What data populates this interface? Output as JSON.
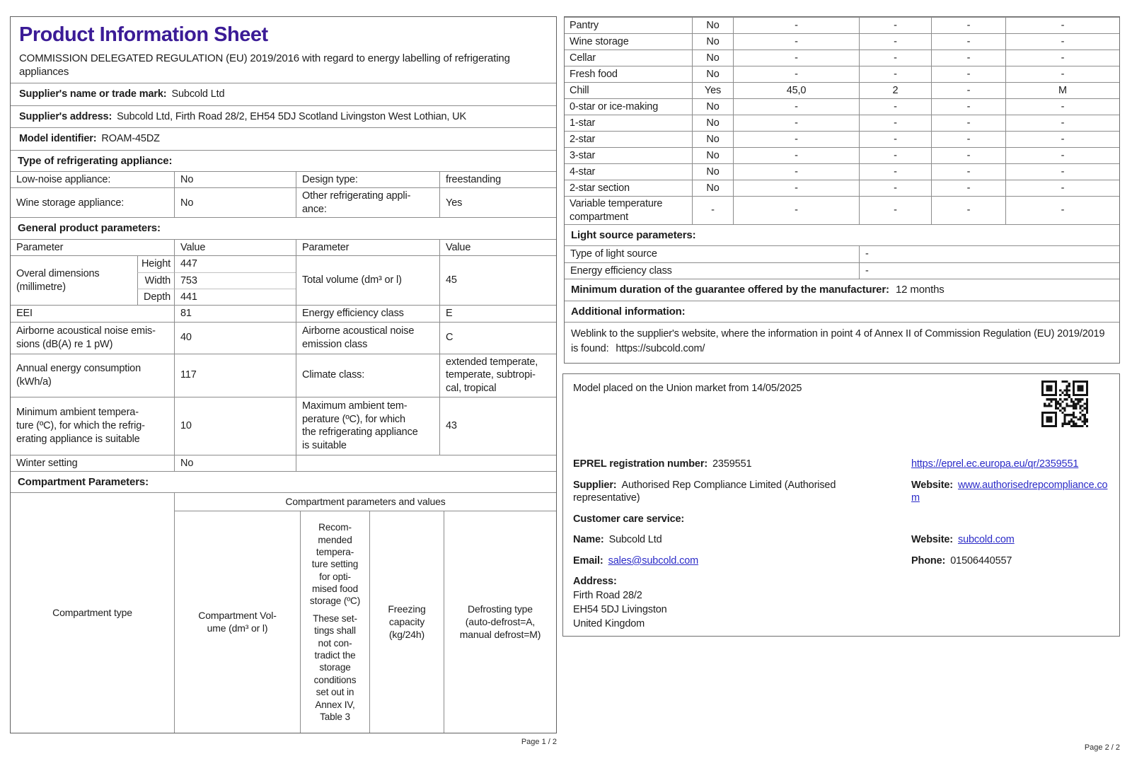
{
  "colors": {
    "title": "#3b1b96",
    "link": "#2b2bc8",
    "border": "#8c8c8c",
    "text": "#1d1d1d"
  },
  "page1": {
    "title": "Product Information Sheet",
    "subtitle": "COMMISSION DELEGATED REGULATION (EU) 2019/2016 with regard to energy labelling of refrigerating appliances",
    "supplier_name": {
      "label": "Supplier's name or trade mark:",
      "value": "Subcold Ltd"
    },
    "supplier_address": {
      "label": "Supplier's address:",
      "value": "Subcold Ltd, Firth Road 28/2, EH54 5DJ Scotland Livingston West Lothian, UK"
    },
    "model_identifier": {
      "label": "Model identifier:",
      "value": "ROAM-45DZ"
    },
    "type_heading": "Type of refrigerating appliance:",
    "low_noise": {
      "label": "Low-noise appliance:",
      "value": "No",
      "label2": "Design type:",
      "value2": "freestanding"
    },
    "wine_storage": {
      "label": "Wine storage appliance:",
      "value": "No",
      "label2": "Other refrigerating appli-\nance:",
      "value2": "Yes"
    },
    "general_heading": "General product parameters:",
    "param_header": {
      "c1": "Parameter",
      "c2": "Value",
      "c3": "Parameter",
      "c4": "Value"
    },
    "dimensions": {
      "label": "Overal dimensions\n(millimetre)",
      "h_label": "Height",
      "h_value": "447",
      "w_label": "Width",
      "w_value": "753",
      "d_label": "Depth",
      "d_value": "441",
      "right_label": "Total volume (dm³ or l)",
      "right_value": "45"
    },
    "rows": [
      {
        "p1": "EEI",
        "v1": "81",
        "p2": "Energy efficiency class",
        "v2": "E"
      },
      {
        "p1": "Airborne acoustical noise emis-\nsions (dB(A) re 1 pW)",
        "v1": "40",
        "p2": "Airborne acoustical noise\nemission class",
        "v2": "C"
      },
      {
        "p1": "Annual energy consumption\n(kWh/a)",
        "v1": "117",
        "p2": "Climate class:",
        "v2": "extended temperate,\ntemperate, subtropi-\ncal, tropical"
      },
      {
        "p1": "Minimum ambient tempera-\nture (ºC), for which the refrig-\nerating appliance is suitable",
        "v1": "10",
        "p2": "Maximum ambient tem-\nperature (ºC), for which\nthe refrigerating appliance\nis suitable",
        "v2": "43"
      }
    ],
    "winter": {
      "label": "Winter setting",
      "value": "No"
    },
    "compartment_heading": "Compartment Parameters:",
    "comp_header": {
      "col1": "Compartment type",
      "span": "Compartment parameters and values",
      "vol": "Compartment Vol-\nume (dm³ or l)",
      "temp1": "Recom-\nmended\ntempera-\nture setting\nfor opti-\nmised food\nstorage (ºC)",
      "temp2": "These set-\ntings shall\nnot con-\ntradict the\nstorage\nconditions\nset out in\nAnnex IV,\nTable 3",
      "freezing": "Freezing\ncapacity\n(kg/24h)",
      "defrost": "Defrosting type\n(auto-defrost=A,\nmanual defrost=M)"
    },
    "footer": "Page 1 / 2"
  },
  "page2": {
    "compartment_rows": [
      [
        "Pantry",
        "No",
        "-",
        "-",
        "-",
        "-"
      ],
      [
        "Wine storage",
        "No",
        "-",
        "-",
        "-",
        "-"
      ],
      [
        "Cellar",
        "No",
        "-",
        "-",
        "-",
        "-"
      ],
      [
        "Fresh food",
        "No",
        "-",
        "-",
        "-",
        "-"
      ],
      [
        "Chill",
        "Yes",
        "45,0",
        "2",
        "-",
        "M"
      ],
      [
        "0-star or ice-making",
        "No",
        "-",
        "-",
        "-",
        "-"
      ],
      [
        "1-star",
        "No",
        "-",
        "-",
        "-",
        "-"
      ],
      [
        "2-star",
        "No",
        "-",
        "-",
        "-",
        "-"
      ],
      [
        "3-star",
        "No",
        "-",
        "-",
        "-",
        "-"
      ],
      [
        "4-star",
        "No",
        "-",
        "-",
        "-",
        "-"
      ],
      [
        "2-star section",
        "No",
        "-",
        "-",
        "-",
        "-"
      ],
      [
        "Variable temperature compartment",
        "-",
        "-",
        "-",
        "-",
        "-"
      ]
    ],
    "light_heading": "Light source parameters:",
    "light_rows": [
      {
        "label": "Type of light source",
        "value": "-"
      },
      {
        "label": "Energy efficiency class",
        "value": "-"
      }
    ],
    "guarantee": {
      "label": "Minimum duration of the guarantee offered by the manufacturer:",
      "value": "12 months"
    },
    "additional_heading": "Additional information:",
    "weblink": {
      "text": "Weblink to the supplier's website, where the information in point 4 of Annex II of Commission Regulation (EU) 2019/2019 is found:",
      "url": "https://subcold.com/"
    },
    "info_box": {
      "market_text": "Model placed on the Union market from 14/05/2025",
      "qr_icon": "qr-code",
      "eprel": {
        "label": "EPREL registration number:",
        "value": "2359551",
        "link": "https://eprel.ec.europa.eu/qr/2359551"
      },
      "supplier": {
        "label": "Supplier:",
        "value": "Authorised Rep Compliance Limited (Authorised representative)"
      },
      "website1": {
        "label": "Website:",
        "link": "www.authorisedrepcompliance.com"
      },
      "customer_heading": "Customer care service:",
      "name": {
        "label": "Name:",
        "value": "Subcold Ltd"
      },
      "website2": {
        "label": "Website:",
        "link": "subcold.com"
      },
      "email": {
        "label": "Email:",
        "link": "sales@subcold.com"
      },
      "phone": {
        "label": "Phone:",
        "value": "01506440557"
      },
      "address": {
        "label": "Address:",
        "lines": "Firth Road 28/2\n EH54 5DJ Livingston\nUnited Kingdom"
      }
    },
    "footer": "Page 2 / 2"
  }
}
